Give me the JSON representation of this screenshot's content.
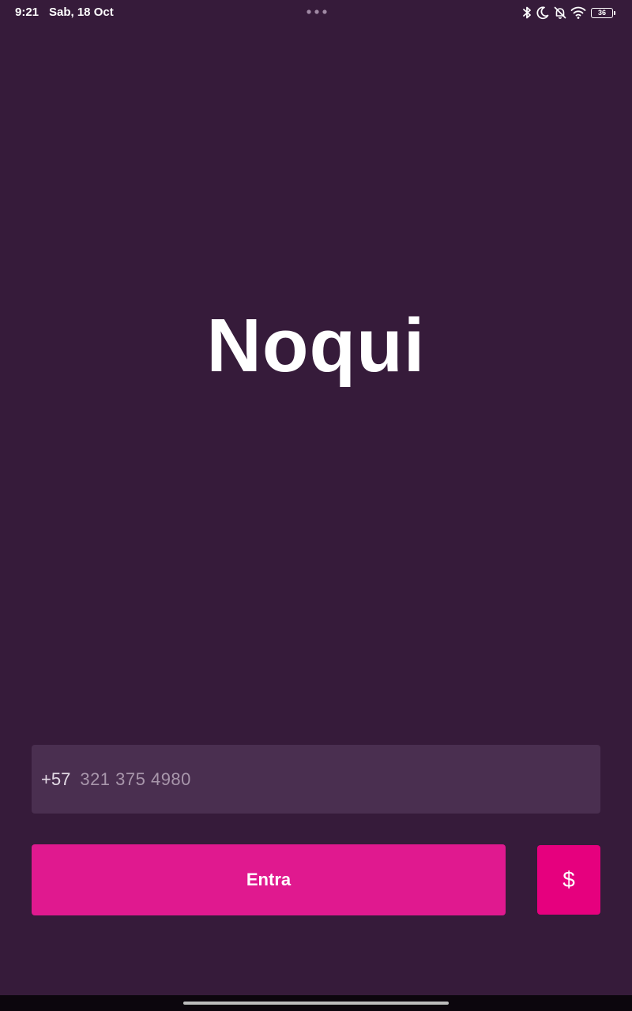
{
  "status_bar": {
    "time": "9:21",
    "date": "Sab, 18 Oct",
    "battery_level": "36",
    "icons": [
      "bluetooth-icon",
      "moon-icon",
      "bell-off-icon",
      "wifi-icon",
      "battery-icon"
    ]
  },
  "app": {
    "title": "Noqui"
  },
  "login": {
    "country_code": "+57",
    "phone_placeholder": "321 375 4980",
    "phone_value": "",
    "enter_label": "Entra",
    "price_label": "$"
  },
  "colors": {
    "background": "#361b3a",
    "field_background": "#4a2f50",
    "primary_button": "#e0198f",
    "secondary_button": "#e6007e",
    "nav_bar": "#0c060d"
  }
}
